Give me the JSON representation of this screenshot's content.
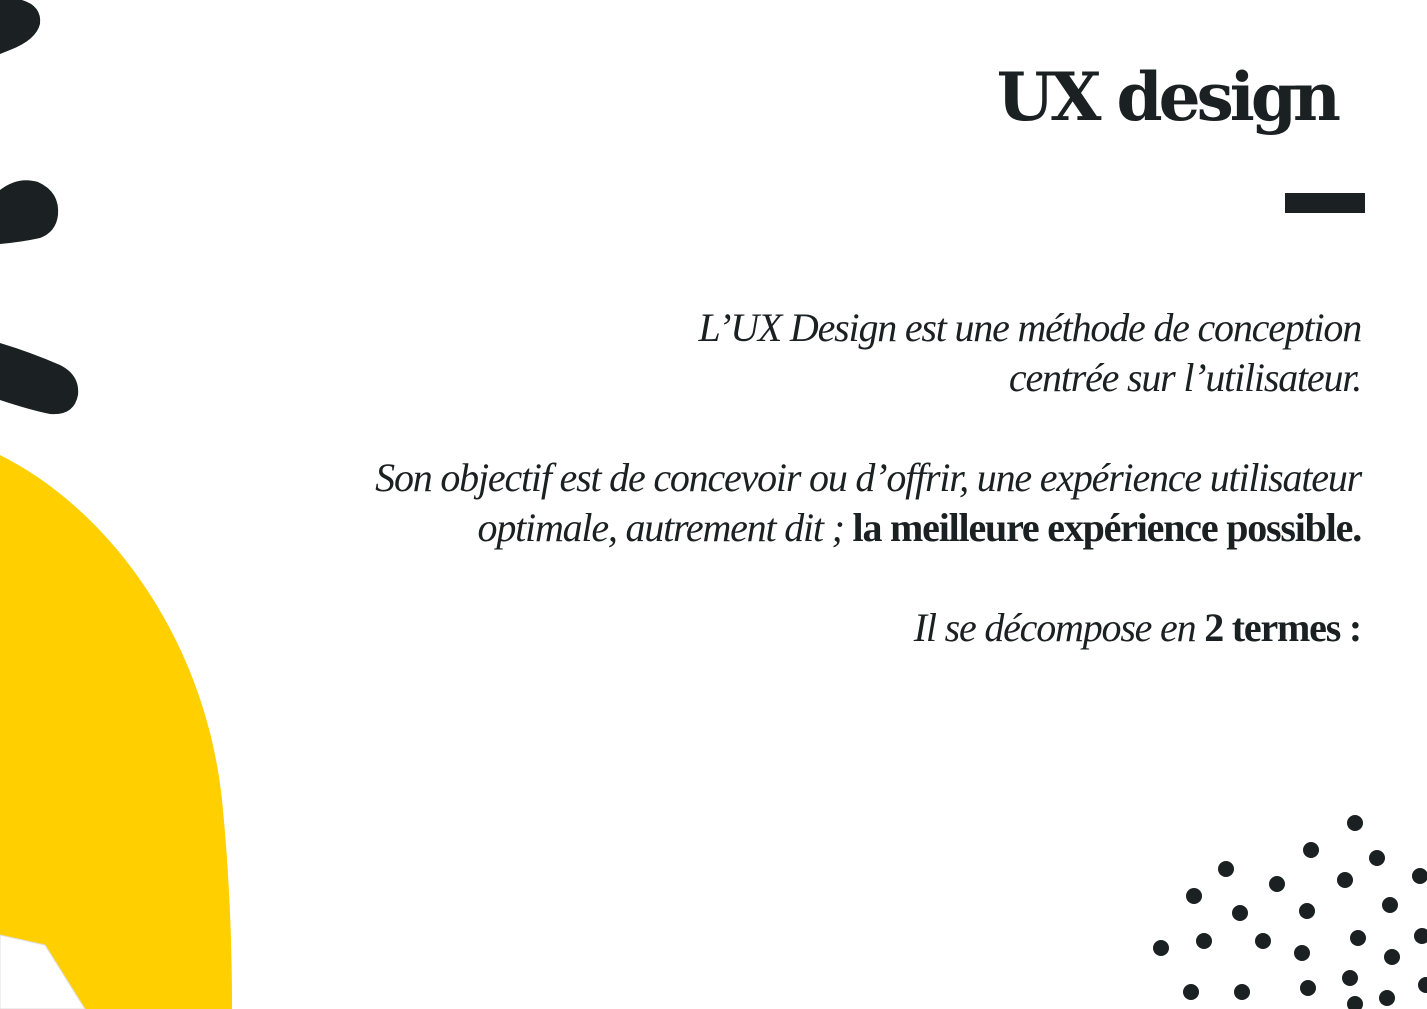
{
  "slide": {
    "title": "UX design",
    "paragraphs": [
      {
        "lines": [
          {
            "italic": "L’UX Design est une méthode de conception",
            "bold": ""
          },
          {
            "italic": "centrée sur l’utilisateur.",
            "bold": ""
          }
        ]
      },
      {
        "lines": [
          {
            "italic": "Son objectif est de concevoir ou d’offrir, une expérience utilisateur",
            "bold": ""
          },
          {
            "italic": "optimale, autrement dit ; ",
            "bold": "la meilleure expérience possible."
          }
        ]
      },
      {
        "lines": [
          {
            "italic": "Il se décompose en ",
            "bold": "2 termes :"
          }
        ]
      }
    ]
  },
  "colors": {
    "text": "#1b2022",
    "accent": "#ffcf00",
    "background": "#ffffff"
  },
  "decorations": {
    "left": "yellow-arch-with-black-brush-strokes",
    "bottom_right": "black-dot-pattern"
  }
}
